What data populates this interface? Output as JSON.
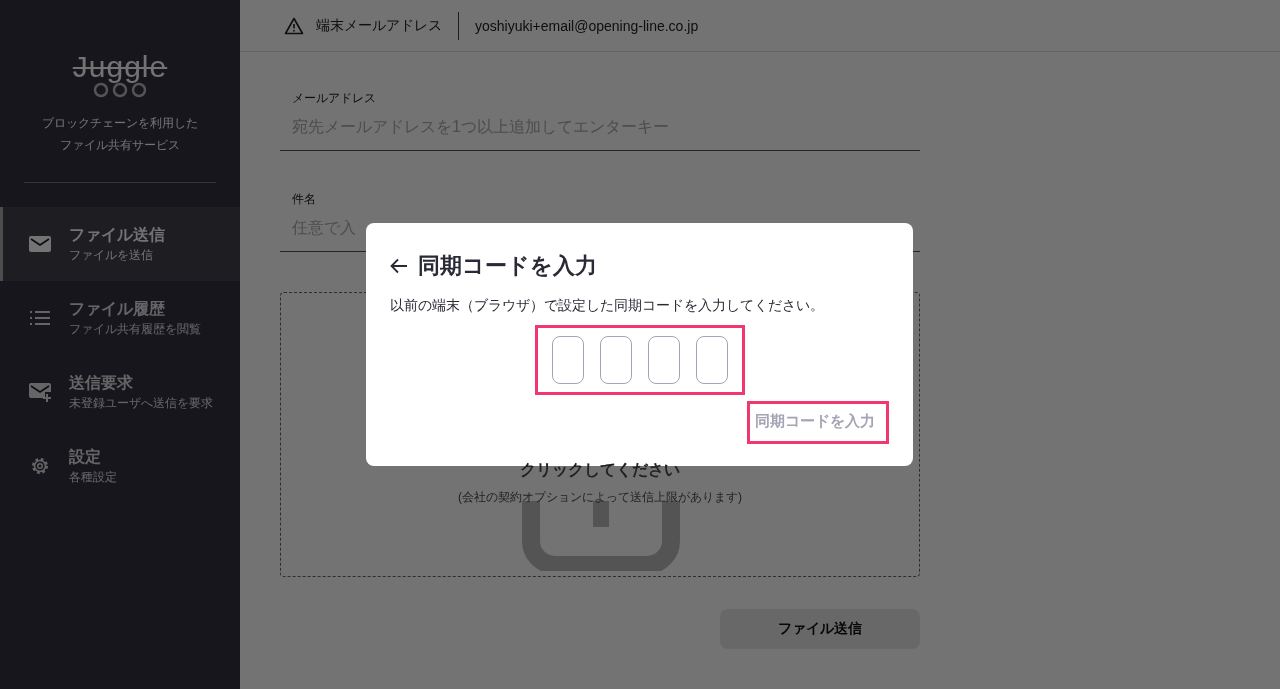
{
  "sidebar": {
    "logo": "Juggle",
    "tagline": [
      "ブロックチェーンを利用した",
      "ファイル共有サービス"
    ],
    "items": [
      {
        "kind": "mail",
        "title": "ファイル送信",
        "subtitle": "ファイルを送信",
        "selected": true
      },
      {
        "kind": "list",
        "title": "ファイル履歴",
        "subtitle": "ファイル共有履歴を閲覧",
        "selected": false
      },
      {
        "kind": "mail-plus",
        "title": "送信要求",
        "subtitle": "未登録ユーザへ送信を要求",
        "selected": false
      },
      {
        "kind": "gear",
        "title": "設定",
        "subtitle": "各種設定",
        "selected": false
      }
    ]
  },
  "header": {
    "label": "端末メールアドレス",
    "email": "yoshiyuki+email@opening-line.co.jp"
  },
  "form": {
    "fields": [
      {
        "label": "メールアドレス",
        "placeholder": "宛先メールアドレスを1つ以上追加してエンターキー"
      },
      {
        "label": "件名",
        "placeholder": "任意で入"
      }
    ],
    "drop_zone": {
      "title": "クリックしてください",
      "note": "(会社の契約オプションによって送信上限があります)"
    },
    "submit": {
      "label": "ファイル送信",
      "disabled": true
    }
  },
  "modal": {
    "title": "同期コードを入力",
    "message": "以前の端末（ブラウザ）で設定した同期コードを入力してください。",
    "code_fields": [
      {
        "filled": false
      },
      {
        "filled": false
      },
      {
        "filled": false
      },
      {
        "filled": false
      }
    ],
    "confirm": {
      "label": "同期コードを入力",
      "disabled": true
    }
  }
}
